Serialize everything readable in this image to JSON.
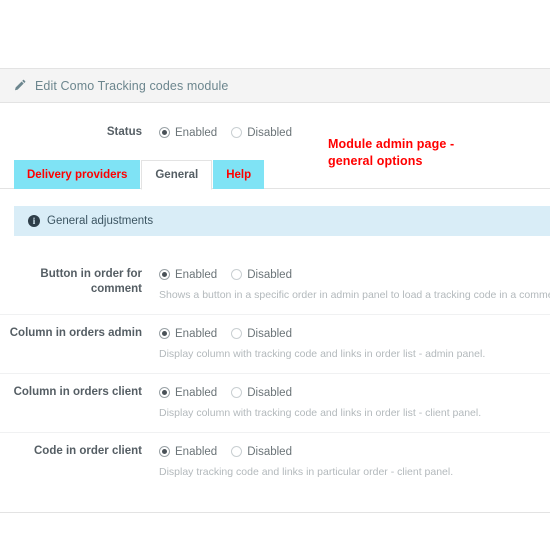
{
  "panel": {
    "title": "Edit Como Tracking codes module",
    "icon": "pencil-icon"
  },
  "status": {
    "label": "Status",
    "options": [
      {
        "label": "Enabled",
        "checked": true
      },
      {
        "label": "Disabled",
        "checked": false
      }
    ]
  },
  "annotation": {
    "text": "Module admin page -\ngeneral options",
    "color": "#ff0000"
  },
  "tabs": [
    {
      "label": "Delivery providers",
      "active": false,
      "highlight": true
    },
    {
      "label": "General",
      "active": true,
      "highlight": false
    },
    {
      "label": "Help",
      "active": false,
      "highlight": true
    }
  ],
  "alert": {
    "icon": "info-icon",
    "icon_glyph": "i",
    "text": "General adjustments",
    "background": "#d9edf7"
  },
  "settings": [
    {
      "label": "Button in order for comment",
      "options": [
        {
          "label": "Enabled",
          "checked": true
        },
        {
          "label": "Disabled",
          "checked": false
        }
      ],
      "help": "Shows a button in a specific order in admin panel to load a tracking code in a comment box - histo"
    },
    {
      "label": "Column in orders admin",
      "options": [
        {
          "label": "Enabled",
          "checked": true
        },
        {
          "label": "Disabled",
          "checked": false
        }
      ],
      "help": "Display column with tracking code and links in order list - admin panel."
    },
    {
      "label": "Column in orders client",
      "options": [
        {
          "label": "Enabled",
          "checked": true
        },
        {
          "label": "Disabled",
          "checked": false
        }
      ],
      "help": "Display column with tracking code and links in order list - client panel."
    },
    {
      "label": "Code in order client",
      "options": [
        {
          "label": "Enabled",
          "checked": true
        },
        {
          "label": "Disabled",
          "checked": false
        }
      ],
      "help": "Display tracking code and links in particular order - client panel."
    }
  ]
}
